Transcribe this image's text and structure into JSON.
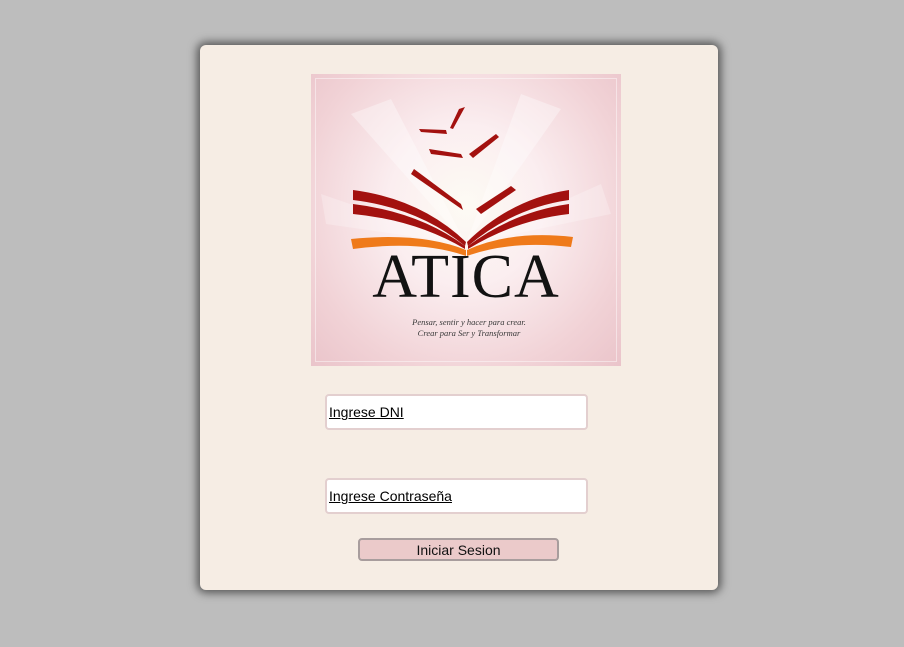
{
  "logo": {
    "wordmark": "ATICA",
    "tagline_line1": "Pensar, sentir y hacer para crear.",
    "tagline_line2": "Crear para Ser y Transformar"
  },
  "login": {
    "dni_placeholder": "Ingrese DNI",
    "password_placeholder": "Ingrese Contraseña",
    "submit_label": "Iniciar Sesion"
  },
  "colors": {
    "page_background": "#bdbdbd",
    "card_background": "#f6ede4",
    "button_background": "#ebcaca",
    "logo_dark_red": "#a3110f",
    "logo_orange": "#ef7a1a"
  }
}
